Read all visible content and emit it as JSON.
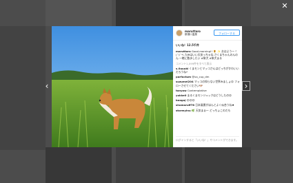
{
  "modal": {
    "close_glyph": "✕",
    "prev_glyph": "‹",
    "next_glyph": "›"
  },
  "post": {
    "username": "maruttaro",
    "location": "那須川温泉",
    "follow_label": "フォローする",
    "likes": "いいね！12.5千件",
    "comments": [
      {
        "user": "maruttaro",
        "text": "Good morning!! 🌻 ✨ おはようーヾ(´▽`*) 九州はいい天気っちゃね さくまちゃんのんのん 一緒に散歩したい #柴犬 #柴犬まる"
      },
      {
        "user": "",
        "text": "コメント1,099件をすべて表示",
        "grey": true
      },
      {
        "user": "s.0uuuki",
        "text": "くまモンとマッコさんはどっちがかわいいだろうね?"
      },
      {
        "user": "parfactum",
        "text": "@vo_cup_dm"
      },
      {
        "user": "suzumei204",
        "text": "マッコの知らない世界みましょ😊 フォローさせてください🐶"
      },
      {
        "user": "tanyaw",
        "text": "Contemplative"
      },
      {
        "user": "yukke0",
        "text": "まるくまモンジュックはどうしたの😊"
      },
      {
        "user": "boogaj",
        "text": "😊😊😊"
      },
      {
        "user": "shomaruff78",
        "text": "日本風景がほんとよく似合うね♠"
      },
      {
        "user": "stormyinu",
        "text": "🌿 天気まぁ〜 どっちょこのだも"
      }
    ],
    "login_prompt": "ログインすると「いいね！」やコメントができます。"
  }
}
